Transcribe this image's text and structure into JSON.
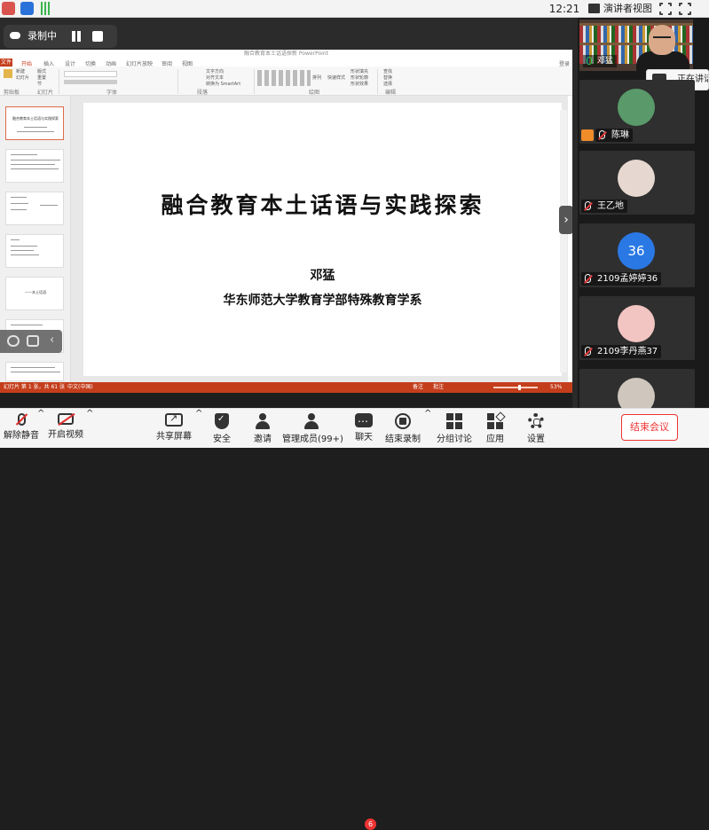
{
  "topbar": {
    "time": "12:21",
    "presenter_view": "演讲者视图",
    "colors": {
      "app1": "#d9534f",
      "app2": "#2a72d9",
      "signal": "#39b54a"
    }
  },
  "recording": {
    "label": "录制中"
  },
  "ppt": {
    "window_title": "融合教育本土话语探新 PowerPoint",
    "tabs": [
      "文件",
      "开始",
      "插入",
      "设计",
      "切换",
      "动画",
      "幻灯片放映",
      "审阅",
      "视图"
    ],
    "active_tab": "开始",
    "account": "登录",
    "ribbon": {
      "clipboard_items": [
        "新建",
        "幻灯片",
        "版式",
        "重置",
        "节"
      ],
      "direction_items": [
        "文字方向",
        "对齐文本",
        "转换为 SmartArt"
      ],
      "style_items": [
        "形状填充",
        "形状轮廓",
        "形状效果",
        "快速样式",
        "排列"
      ],
      "edit_items": [
        "查找",
        "替换",
        "选择"
      ],
      "groups": [
        "剪贴板",
        "幻灯片",
        "字体",
        "段落",
        "绘图",
        "编辑"
      ]
    },
    "thumbnails": [
      {
        "num": "1",
        "text": "融合教育本土话语与实践探索"
      },
      {
        "num": "2",
        "text": ""
      },
      {
        "num": "3",
        "text": ""
      },
      {
        "num": "4",
        "text": ""
      },
      {
        "num": "5",
        "text": "——本土话语"
      },
      {
        "num": "6",
        "text": ""
      },
      {
        "num": "7",
        "text": ""
      }
    ],
    "slide": {
      "title": "融合教育本土话语与实践探索",
      "author": "邓猛",
      "affiliation": "华东师范大学教育学部特殊教育学系"
    },
    "status": {
      "slide_info": "幻灯片 第 1 张，共 61 张",
      "language": "中文(中国)",
      "notes": "备注",
      "comments": "批注",
      "zoom": "53%"
    }
  },
  "participants": {
    "host": {
      "name": "邓猛"
    },
    "speaking": "正在讲话",
    "tiles": [
      {
        "name": "陈琳",
        "avatar_color": "#5a9a6a",
        "text": "",
        "host_badge": true
      },
      {
        "name": "王乙地",
        "avatar_color": "#e6d8d0",
        "text": ""
      },
      {
        "name": "2109孟婷婷36",
        "avatar_color": "#2a78e4",
        "text": "36"
      },
      {
        "name": "2109李丹燕37",
        "avatar_color": "#f2c4c2",
        "text": ""
      },
      {
        "name": "",
        "avatar_color": "#cfc7bd",
        "text": ""
      }
    ]
  },
  "toolbar": {
    "unmute": "解除静音",
    "video": "开启视频",
    "share": "共享屏幕",
    "security": "安全",
    "invite": "邀请",
    "members": "管理成员(99+)",
    "chat": "聊天",
    "chat_badge": "6",
    "stop_record": "结束录制",
    "breakout": "分组讨论",
    "apps": "应用",
    "settings": "设置",
    "end_meeting": "结束会议",
    "colors": {
      "danger": "#e33333"
    }
  }
}
